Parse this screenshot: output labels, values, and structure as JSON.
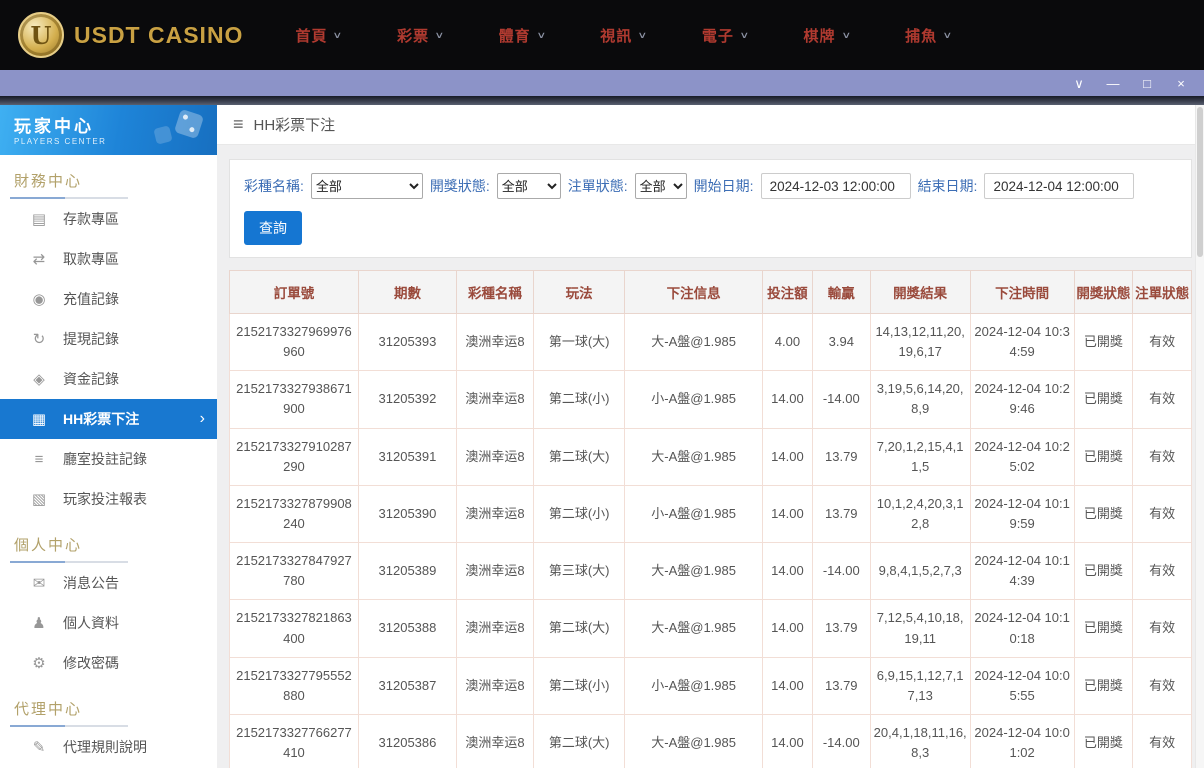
{
  "topbar": {
    "logo_letter": "U",
    "logo_text": "USDT CASINO",
    "nav": [
      {
        "label": "首頁"
      },
      {
        "label": "彩票"
      },
      {
        "label": "體育"
      },
      {
        "label": "視訊"
      },
      {
        "label": "電子"
      },
      {
        "label": "棋牌"
      },
      {
        "label": "捕魚"
      }
    ]
  },
  "titlebar": {
    "controls": [
      {
        "name": "collapse",
        "glyph": "∨"
      },
      {
        "name": "minimize",
        "glyph": "—"
      },
      {
        "name": "maximize",
        "glyph": "□"
      },
      {
        "name": "close",
        "glyph": "×"
      }
    ]
  },
  "sidebar": {
    "title": "玩家中心",
    "subtitle": "PLAYERS CENTER",
    "sections": [
      {
        "heading": "財務中心",
        "items": [
          {
            "label": "存款專區",
            "icon": "deposit-card-icon",
            "glyph": "▤"
          },
          {
            "label": "取款專區",
            "icon": "withdraw-icon",
            "glyph": "⇄"
          },
          {
            "label": "充值記錄",
            "icon": "recharge-record-icon",
            "glyph": "◉"
          },
          {
            "label": "提現記錄",
            "icon": "cashout-record-icon",
            "glyph": "↻"
          },
          {
            "label": "資金記錄",
            "icon": "funds-record-icon",
            "glyph": "◈"
          },
          {
            "label": "HH彩票下注",
            "icon": "lottery-bet-icon",
            "glyph": "▦",
            "active": true
          },
          {
            "label": "廳室投註記錄",
            "icon": "hall-bet-record-icon",
            "glyph": "≡"
          },
          {
            "label": "玩家投注報表",
            "icon": "bet-report-icon",
            "glyph": "▧"
          }
        ]
      },
      {
        "heading": "個人中心",
        "items": [
          {
            "label": "消息公告",
            "icon": "bell-icon",
            "glyph": "✉"
          },
          {
            "label": "個人資料",
            "icon": "user-icon",
            "glyph": "♟"
          },
          {
            "label": "修改密碼",
            "icon": "gear-icon",
            "glyph": "⚙"
          }
        ]
      },
      {
        "heading": "代理中心",
        "items": [
          {
            "label": "代理規則說明",
            "icon": "doc-icon",
            "glyph": "✎"
          }
        ]
      }
    ]
  },
  "main": {
    "page_title": "HH彩票下注",
    "filters": {
      "lottery_label": "彩種名稱:",
      "lottery_value": "全部",
      "draw_status_label": "開獎狀態:",
      "draw_status_value": "全部",
      "order_status_label": "注單狀態:",
      "order_status_value": "全部",
      "start_label": "開始日期:",
      "start_value": "2024-12-03 12:00:00",
      "end_label": "結束日期:",
      "end_value": "2024-12-04 12:00:00",
      "search_button": "查詢"
    },
    "table": {
      "headers": [
        "訂單號",
        "期數",
        "彩種名稱",
        "玩法",
        "下注信息",
        "投注額",
        "輸贏",
        "開獎結果",
        "下注時間",
        "開獎狀態",
        "注單狀態"
      ],
      "rows": [
        [
          "2152173327969976960",
          "31205393",
          "澳洲幸运8",
          "第一球(大)",
          "大-A盤@1.985",
          "4.00",
          "3.94",
          "14,13,12,11,20,19,6,17",
          "2024-12-04 10:34:59",
          "已開獎",
          "有效"
        ],
        [
          "2152173327938671900",
          "31205392",
          "澳洲幸运8",
          "第二球(小)",
          "小-A盤@1.985",
          "14.00",
          "-14.00",
          "3,19,5,6,14,20,8,9",
          "2024-12-04 10:29:46",
          "已開獎",
          "有效"
        ],
        [
          "2152173327910287290",
          "31205391",
          "澳洲幸运8",
          "第二球(大)",
          "大-A盤@1.985",
          "14.00",
          "13.79",
          "7,20,1,2,15,4,11,5",
          "2024-12-04 10:25:02",
          "已開獎",
          "有效"
        ],
        [
          "2152173327879908240",
          "31205390",
          "澳洲幸运8",
          "第二球(小)",
          "小-A盤@1.985",
          "14.00",
          "13.79",
          "10,1,2,4,20,3,12,8",
          "2024-12-04 10:19:59",
          "已開獎",
          "有效"
        ],
        [
          "2152173327847927780",
          "31205389",
          "澳洲幸运8",
          "第三球(大)",
          "大-A盤@1.985",
          "14.00",
          "-14.00",
          "9,8,4,1,5,2,7,3",
          "2024-12-04 10:14:39",
          "已開獎",
          "有效"
        ],
        [
          "2152173327821863400",
          "31205388",
          "澳洲幸运8",
          "第二球(大)",
          "大-A盤@1.985",
          "14.00",
          "13.79",
          "7,12,5,4,10,18,19,11",
          "2024-12-04 10:10:18",
          "已開獎",
          "有效"
        ],
        [
          "2152173327795552880",
          "31205387",
          "澳洲幸运8",
          "第二球(小)",
          "小-A盤@1.985",
          "14.00",
          "13.79",
          "6,9,15,1,12,7,17,13",
          "2024-12-04 10:05:55",
          "已開獎",
          "有效"
        ],
        [
          "2152173327766277410",
          "31205386",
          "澳洲幸运8",
          "第二球(大)",
          "大-A盤@1.985",
          "14.00",
          "-14.00",
          "20,4,1,18,11,16,8,3",
          "2024-12-04 10:01:02",
          "已開獎",
          "有效"
        ]
      ]
    }
  }
}
